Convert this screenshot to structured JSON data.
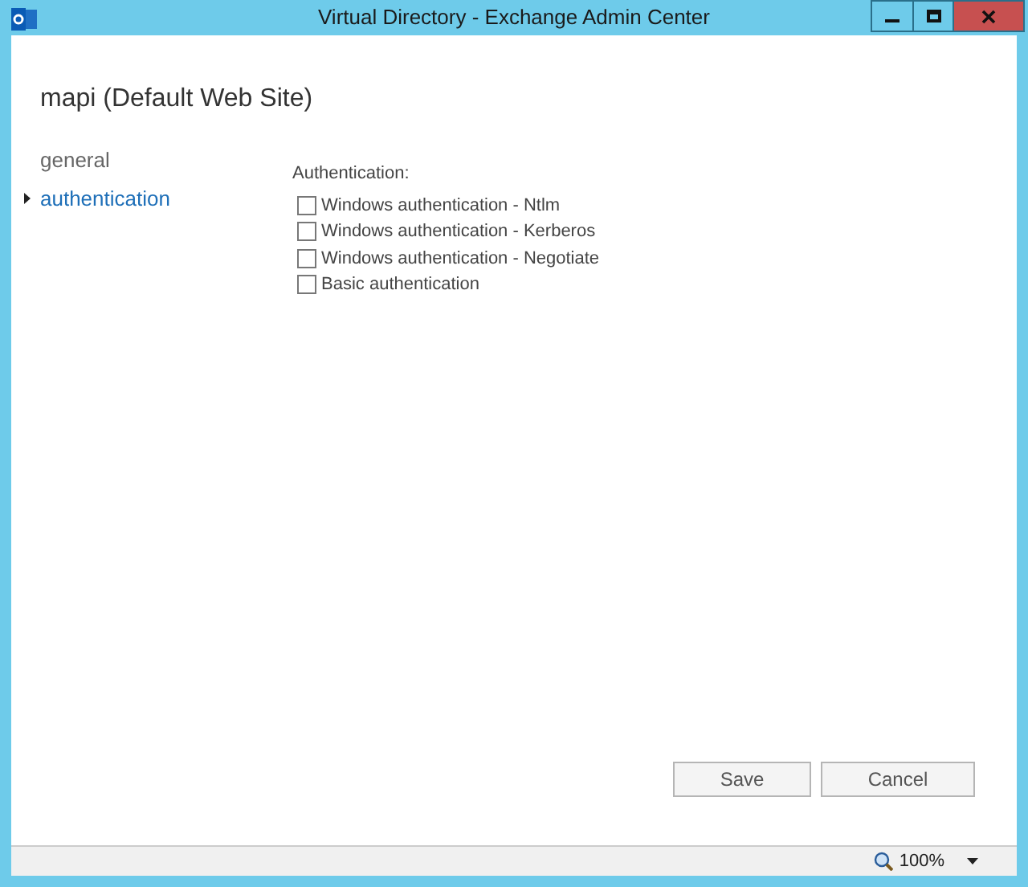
{
  "window": {
    "title": "Virtual Directory - Exchange Admin Center"
  },
  "heading": "mapi (Default Web Site)",
  "nav": [
    {
      "label": "general",
      "selected": false
    },
    {
      "label": "authentication",
      "selected": true
    }
  ],
  "section_label": "Authentication:",
  "options": [
    {
      "label": "Windows authentication - Ntlm",
      "checked": false
    },
    {
      "label": "Windows authentication - Kerberos",
      "checked": false
    },
    {
      "label": "Windows authentication - Negotiate",
      "checked": false
    },
    {
      "label": "Basic authentication",
      "checked": false
    }
  ],
  "buttons": [
    "Save",
    "Cancel"
  ],
  "status_bar": {
    "zoom": "100%"
  }
}
